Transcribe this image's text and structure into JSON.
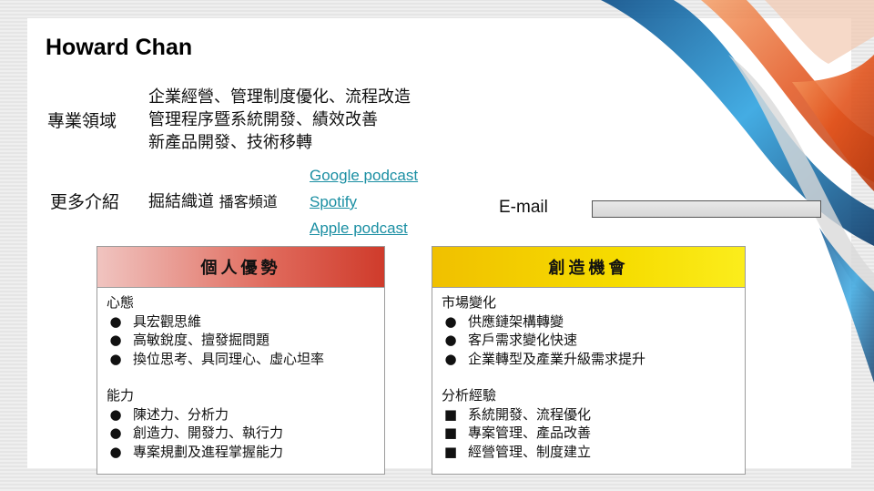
{
  "slide": {
    "name": "Howard Chan",
    "expertise_label": "專業領域",
    "expertise_lines": [
      "企業經營、管理制度優化、流程改造",
      "管理程序暨系統開發、績效改善",
      "新產品開發、技術移轉"
    ],
    "more_label": "更多介紹",
    "more_text": "掘結織道",
    "more_sub": "播客頻道",
    "podcasts": [
      "Google podcast",
      "Spotify",
      "Apple podcast"
    ],
    "email_label": "E-mail"
  },
  "cards": {
    "strengths": {
      "title": "個人優勢",
      "sections": [
        {
          "title": "心態",
          "items": [
            "具宏觀思維",
            "高敏銳度、擅發掘問題",
            "換位思考、具同理心、虛心坦率"
          ]
        },
        {
          "title": "能力",
          "items": [
            "陳述力、分析力",
            "創造力、開發力、執行力",
            "專案規劃及進程掌握能力"
          ]
        }
      ]
    },
    "opportunities": {
      "title": "創造機會",
      "sections": [
        {
          "title": "市場變化",
          "items": [
            "供應鏈架構轉變",
            "客戶需求變化快速",
            "企業轉型及產業升級需求提升"
          ]
        },
        {
          "title": "分析經驗",
          "items": [
            "系統開發、流程優化",
            "專案管理、產品改善",
            "經營管理、制度建立"
          ]
        }
      ]
    }
  },
  "colors": {
    "link": "#1b8fa3",
    "strengths_header": "#cf3b2b",
    "opportunities_header": "#f6dc00"
  },
  "icons": {
    "round_bullet": "●",
    "square_bullet": "■"
  }
}
